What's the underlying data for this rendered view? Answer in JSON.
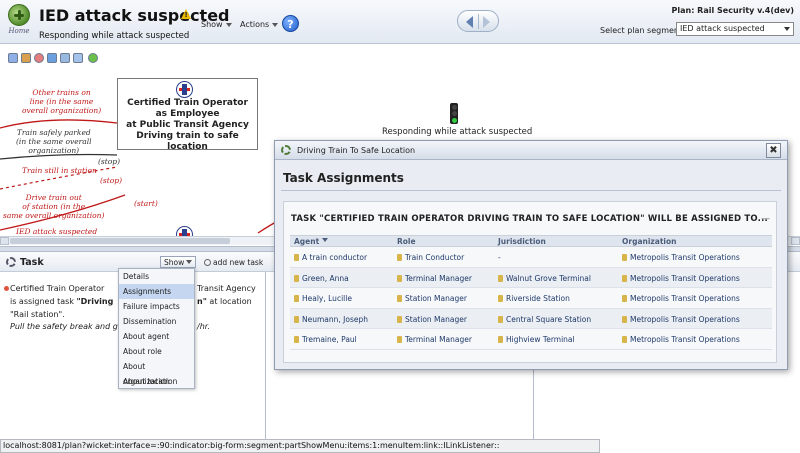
{
  "header": {
    "home_label": "Home",
    "title": "IED attack suspected",
    "subtitle": "Responding while attack suspected",
    "show_label": "Show",
    "actions_label": "Actions",
    "help_symbol": "?",
    "plan_label": "Plan: Rail Security v.4(dev)",
    "segment_label": "Select plan segment:",
    "segment_value": "IED attack suspected"
  },
  "flowmap": {
    "labels": [
      "Other trains on",
      "line (in the same",
      "overall organization)",
      "Train safely parked",
      "(in the same overall",
      "organization)",
      "(stop)",
      "Train still in station",
      "(stop)",
      "Drive train out",
      "of station (in the",
      "same overall organization)",
      "(start)",
      "IED attack suspected"
    ],
    "node_lines": [
      "Certified Train Operator",
      "as Employee",
      "at Public Transit Agency",
      "Driving train to safe location"
    ],
    "event_label": "Responding while attack suspected"
  },
  "task_panel": {
    "title": "Task",
    "show_label": "Show",
    "add_task_label": "add new task",
    "body_line1": "Certified Train Operator",
    "body_line1b": "Transit Agency",
    "body_line2a": "is assigned task ",
    "body_line2b": "\"Driving",
    "body_line2c": "n\"",
    "body_line2d": " at location",
    "body_line3": "\"Rail station\".",
    "note_a": "Pull the safety break and go",
    "note_b": "/hr."
  },
  "show_menu": {
    "items": [
      "Details",
      "Assignments",
      "Failure impacts",
      "Dissemination",
      "About agent",
      "About role",
      "About organization",
      "About location"
    ],
    "active": "Assignments"
  },
  "dialog": {
    "title": "Driving Train To Safe Location",
    "close_symbol": "✖",
    "heading": "Task Assignments",
    "assign_title": "TASK \"CERTIFIED TRAIN OPERATOR DRIVING TRAIN TO SAFE LOCATION\" WILL BE ASSIGNED TO...",
    "collapse_symbol": "—",
    "columns": [
      "Agent",
      "Role",
      "Jurisdiction",
      "Organization"
    ],
    "rows": [
      {
        "agent": "A train conductor",
        "role": "Train Conductor",
        "jurisdiction": "-",
        "organization": "Metropolis Transit Operations"
      },
      {
        "agent": "Green, Anna",
        "role": "Terminal Manager",
        "jurisdiction": "Walnut Grove Terminal",
        "organization": "Metropolis Transit Operations"
      },
      {
        "agent": "Healy, Lucille",
        "role": "Station Manager",
        "jurisdiction": "Riverside Station",
        "organization": "Metropolis Transit Operations"
      },
      {
        "agent": "Neumann, Joseph",
        "role": "Station Manager",
        "jurisdiction": "Central Square Station",
        "organization": "Metropolis Transit Operations"
      },
      {
        "agent": "Tremaine, Paul",
        "role": "Terminal Manager",
        "jurisdiction": "Highview Terminal",
        "organization": "Metropolis Transit Operations"
      }
    ]
  },
  "statusbar": {
    "url": "localhost:8081/plan?wicket:interface=:90:indicator:big-form:segment:partShowMenu:items:1:menuItem:link::ILinkListener::"
  },
  "colors": {
    "accent": "#1e5bc6",
    "flow_red": "#c01818",
    "link_blue": "#1f3a6a"
  }
}
